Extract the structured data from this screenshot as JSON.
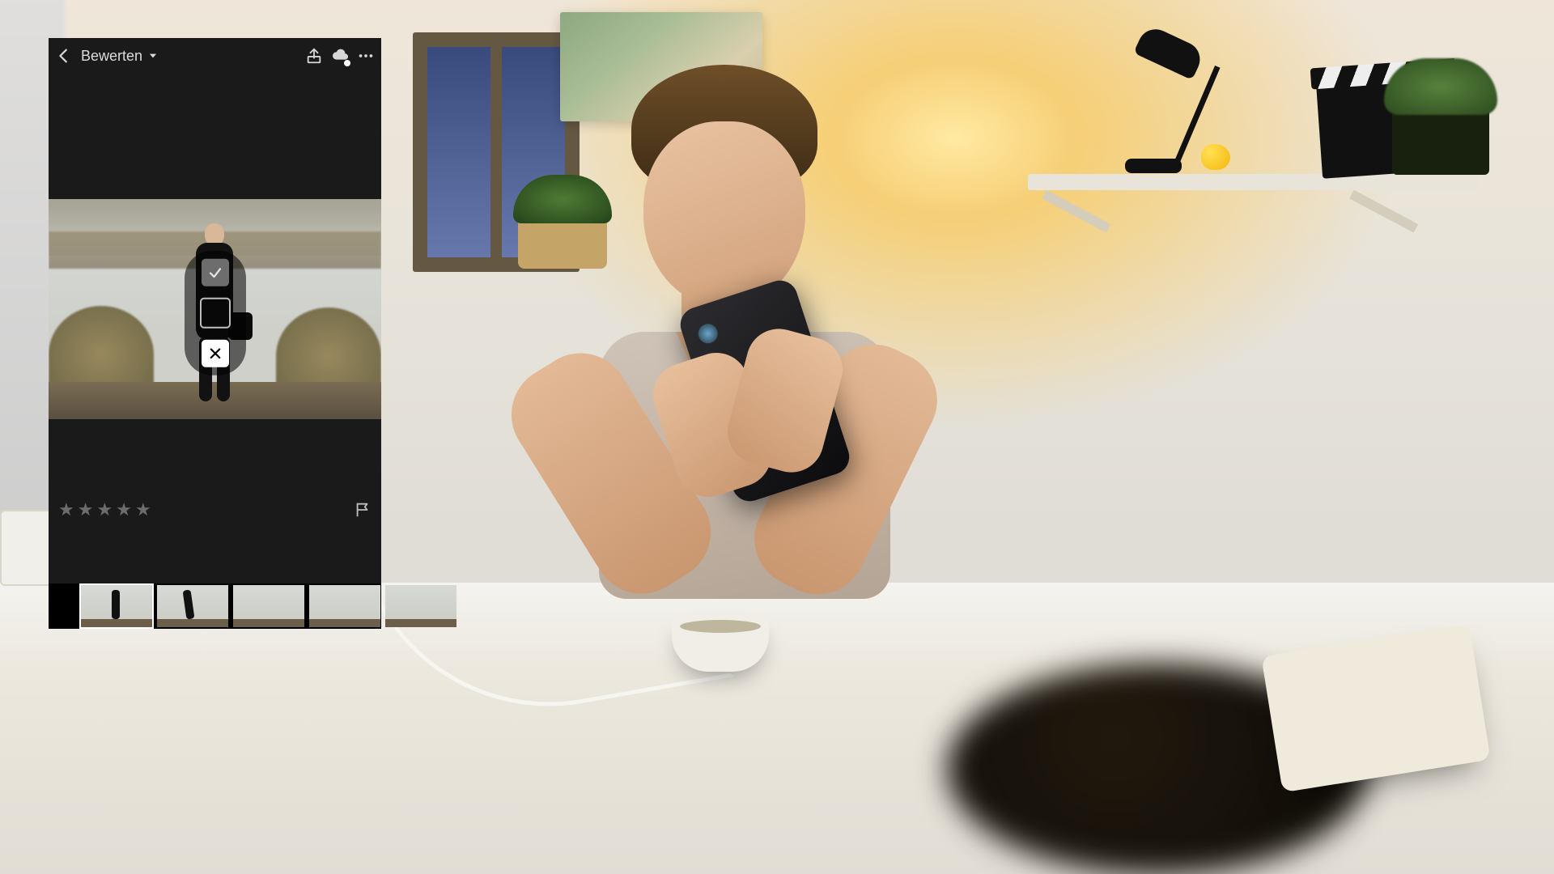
{
  "header": {
    "mode_label": "Bewerten",
    "icons": {
      "back": "back-icon",
      "dropdown": "chevron-down-icon",
      "share": "share-icon",
      "cloud": "cloud-sync-icon",
      "more": "more-icon"
    }
  },
  "flag_popover": {
    "options": [
      "picked",
      "unflagged",
      "rejected"
    ],
    "selected": "rejected"
  },
  "rating": {
    "stars": 0,
    "max": 5
  },
  "flag_state": "unflagged",
  "filmstrip": {
    "selected_index": 0,
    "thumbs": [
      {
        "desc": "man-standing-front",
        "pose": "front"
      },
      {
        "desc": "man-arm-out",
        "pose": "pose2"
      },
      {
        "desc": "lake-empty",
        "pose": "none"
      },
      {
        "desc": "lake-empty-2",
        "pose": "none"
      },
      {
        "desc": "lake-partial",
        "pose": "none"
      }
    ]
  },
  "colors": {
    "panel_bg": "#1a1a1a",
    "text": "#e6e6e6",
    "selection": "#ffffff"
  }
}
